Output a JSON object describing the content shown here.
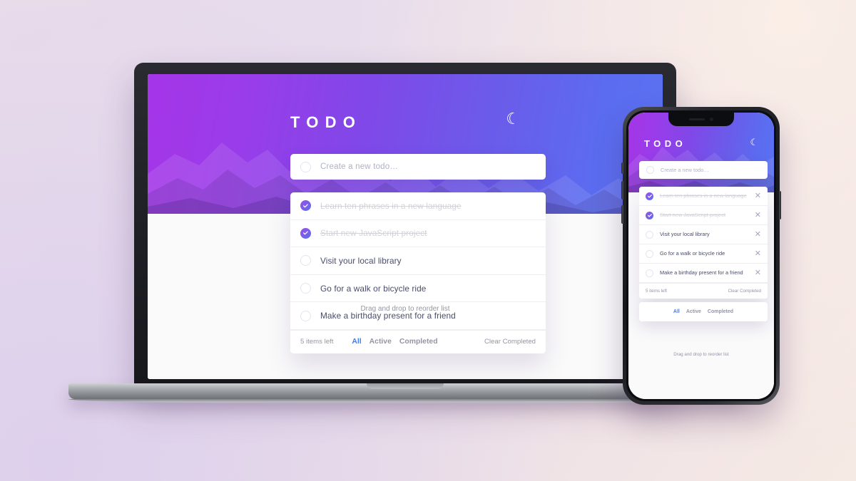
{
  "app": {
    "brand": "TODO",
    "theme_toggle_icon": "moon-icon",
    "new_todo_placeholder": "Create a new todo…",
    "items_left": "5 items left",
    "clear_completed": "Clear Completed",
    "drag_hint": "Drag and drop to reorder list",
    "accent_color": "#3a7cfd",
    "check_gradient_from": "#9a4fe6",
    "check_gradient_to": "#5a6ef0",
    "text_color": "#494c6b",
    "muted_color": "#9495a5"
  },
  "todos": [
    {
      "label": "Learn ten phrases in a new language",
      "completed": true,
      "delete_icon": "close-icon"
    },
    {
      "label": "Start new JavaScript project",
      "completed": true,
      "delete_icon": "close-icon"
    },
    {
      "label": "Visit your local library",
      "completed": false,
      "delete_icon": "close-icon"
    },
    {
      "label": "Go for a walk or bicycle ride",
      "completed": false,
      "delete_icon": "close-icon"
    },
    {
      "label": "Make a birthday present for a friend",
      "completed": false,
      "delete_icon": "close-icon"
    }
  ],
  "filters": [
    {
      "label": "All",
      "active": true
    },
    {
      "label": "Active",
      "active": false
    },
    {
      "label": "Completed",
      "active": false
    }
  ],
  "background": {
    "top_left": "#e9dcea",
    "top_right": "#faeee7",
    "bottom_left": "#ddd0ec",
    "bottom_right": "#f3e6e4"
  }
}
